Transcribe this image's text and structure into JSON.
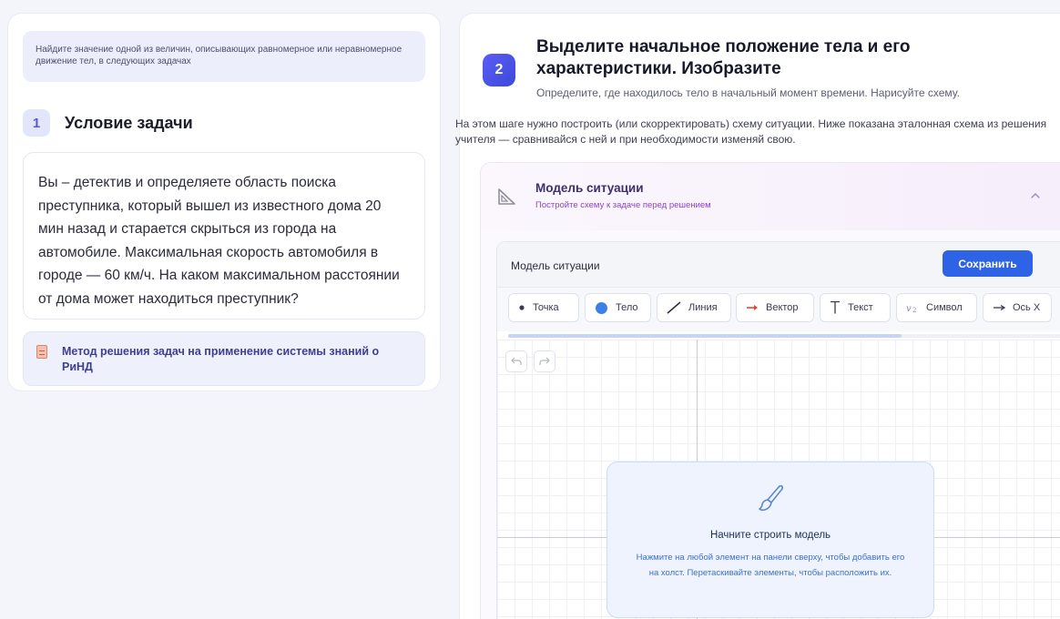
{
  "left": {
    "task_type": "Найдите значение одной из величин, описывающих равномерное или неравномерное движение тел, в следующих задачах",
    "step_number": "1",
    "step_title": "Условие задачи",
    "problem_text": "Вы – детектив и определяете область поиска преступника, который вышел из известного дома 20 мин назад и старается скрыться из города на автомобиле. Максимальная скорость автомобиля в городе — 60 км/ч. На каком максимальном расстоянии от дома может находиться преступник?",
    "method_link": "Метод решения задач на применение системы знаний о РиНД"
  },
  "right": {
    "step_number": "2",
    "step_title": "Выделите начальное положение тела и его характеристики. Изобразите",
    "step_subtitle": "Определите, где находилось тело в начальный момент времени. Нарисуйте схему.",
    "description": "На этом шаге нужно построить (или скорректировать) схему ситуации. Ниже показана эталонная схема из решения учителя — сравнивайся с ней и при необходимости изменяй свою.",
    "model": {
      "title": "Модель ситуации",
      "subtitle": "Постройте схему к задаче перед решением",
      "editor_title": "Модель ситуации",
      "save_label": "Сохранить",
      "tools": {
        "point": "Точка",
        "body": "Тело",
        "line": "Линия",
        "vector": "Вектор",
        "text": "Текст",
        "symbol": "Символ",
        "axis_x": "Ось X"
      },
      "empty_title": "Начните строить модель",
      "empty_text": "Нажмите на любой элемент на панели сверху, чтобы добавить его на холст. Перетаскивайте элементы, чтобы расположить их."
    }
  },
  "colors": {
    "accent": "#2f63e6",
    "step_badge": "#4f51e8",
    "model_subtitle": "#8e3fd1",
    "hint_text": "#3d6fd0"
  },
  "icons": {
    "method": "clipboard-icon",
    "model": "triangle-ruler-icon",
    "collapse": "chevron-up-icon",
    "undo": "undo-icon",
    "redo": "redo-icon",
    "empty_state": "brush-icon"
  }
}
